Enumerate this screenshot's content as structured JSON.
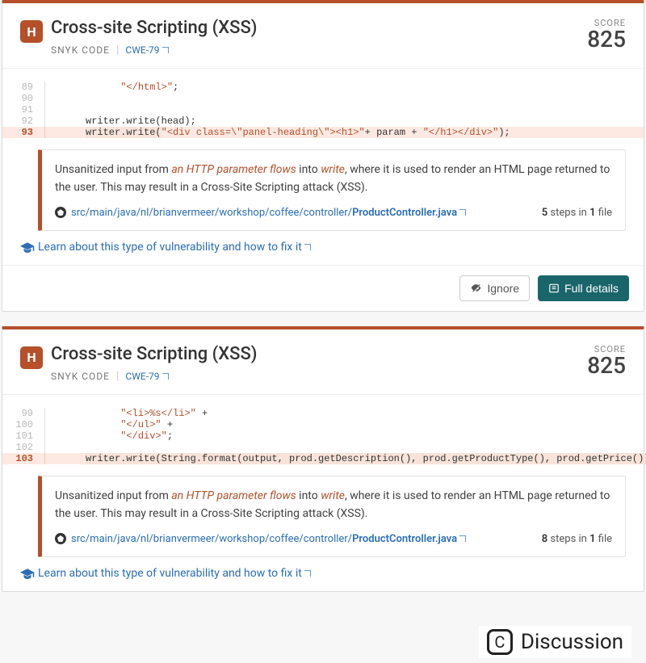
{
  "issues": [
    {
      "severity_letter": "H",
      "title": "Cross-site Scripting (XSS)",
      "source": "SNYK CODE",
      "cwe": "CWE-79",
      "score_label": "SCORE",
      "score": "825",
      "code_lines": [
        {
          "n": "89",
          "hl": false,
          "segs": [
            {
              "t": "str",
              "v": "\"</html>\""
            },
            {
              "t": "",
              "v": ";"
            }
          ]
        },
        {
          "n": "90",
          "hl": false,
          "segs": []
        },
        {
          "n": "91",
          "hl": false,
          "segs": []
        },
        {
          "n": "92",
          "hl": false,
          "indent": 1,
          "segs": [
            {
              "t": "",
              "v": "writer.write(head);"
            }
          ]
        },
        {
          "n": "93",
          "hl": true,
          "indent": 1,
          "segs": [
            {
              "t": "mark",
              "v": "writer.write("
            },
            {
              "t": "str",
              "v": "\"<div class=\\\"panel-heading\\\"><h1>\""
            },
            {
              "t": "",
              "v": "+ param + "
            },
            {
              "t": "str",
              "v": "\"</h1></div>\""
            },
            {
              "t": "",
              "v": ");"
            }
          ]
        }
      ],
      "info_pre": "Unsanitized input from ",
      "info_em1": "an HTTP parameter flows",
      "info_mid": " into ",
      "info_em2": "write",
      "info_post": ", where it is used to render an HTML page returned to the user. This may result in a Cross-Site Scripting attack (XSS).",
      "path_prefix": "src/main/java/nl/brianvermeer/workshop/coffee/controller/",
      "path_file": "ProductController.java",
      "steps_n": "5",
      "files_n": "1",
      "steps_l1": " steps in ",
      "steps_l2": " file",
      "learn": "Learn about this type of vulnerability and how to fix it",
      "actions": {
        "ignore": "Ignore",
        "full": "Full details"
      },
      "show_footer": true
    },
    {
      "severity_letter": "H",
      "title": "Cross-site Scripting (XSS)",
      "source": "SNYK CODE",
      "cwe": "CWE-79",
      "score_label": "SCORE",
      "score": "825",
      "code_lines": [
        {
          "n": "99",
          "hl": false,
          "segs": [
            {
              "t": "str",
              "v": "\"<li>%s</li>\""
            },
            {
              "t": "",
              "v": " +"
            }
          ]
        },
        {
          "n": "100",
          "hl": false,
          "segs": [
            {
              "t": "str",
              "v": "\"</ul>\""
            },
            {
              "t": "",
              "v": " +"
            }
          ]
        },
        {
          "n": "101",
          "hl": false,
          "segs": [
            {
              "t": "str",
              "v": "\"</div>\""
            },
            {
              "t": "",
              "v": ";"
            }
          ]
        },
        {
          "n": "102",
          "hl": false,
          "segs": []
        },
        {
          "n": "103",
          "hl": true,
          "indent": 1,
          "segs": [
            {
              "t": "mark",
              "v": "writer.write(String.format(output, prod.getDescription(), prod.getProductType(), prod.getPrice()));"
            }
          ]
        }
      ],
      "info_pre": "Unsanitized input from ",
      "info_em1": "an HTTP parameter flows",
      "info_mid": " into ",
      "info_em2": "write",
      "info_post": ", where it is used to render an HTML page returned to the user. This may result in a Cross-Site Scripting attack (XSS).",
      "path_prefix": "src/main/java/nl/brianvermeer/workshop/coffee/controller/",
      "path_file": "ProductController.java",
      "steps_n": "8",
      "files_n": "1",
      "steps_l1": " steps in ",
      "steps_l2": " file",
      "learn": "Learn about this type of vulnerability and how to fix it",
      "actions": {
        "ignore": "Ignore",
        "full": "Full details"
      },
      "show_footer": false
    }
  ],
  "discussion_label": "Discussion",
  "discussion_icon": "C"
}
